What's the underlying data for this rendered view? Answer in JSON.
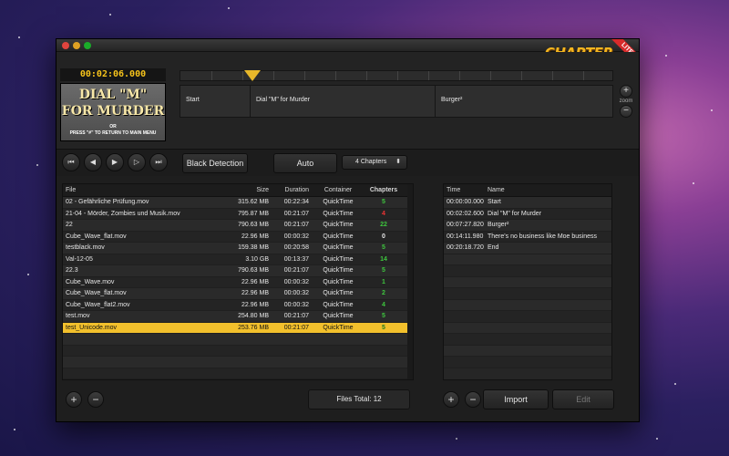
{
  "app": {
    "logo_text": "CHAPTER",
    "logo_suffix": "it",
    "badge": "LITE"
  },
  "preview": {
    "timecode": "00:02:06.000",
    "title_line1": "DIAL \"M\"",
    "title_line2": "FOR MURDER",
    "caption_line1": "OR",
    "caption_line2": "PRESS \"#\" TO RETURN TO MAIN MENU"
  },
  "timeline": {
    "playhead": "current-position"
  },
  "chapters_track": [
    {
      "label": "Start"
    },
    {
      "label": "Dial \"M\" for Murder"
    },
    {
      "label": "Burger²"
    }
  ],
  "zoom": {
    "label": "zoom",
    "plus": "+",
    "minus": "−"
  },
  "toolbar": {
    "transport": [
      {
        "name": "skip-to-start-icon",
        "glyph": "⏮"
      },
      {
        "name": "previous-icon",
        "glyph": "◀"
      },
      {
        "name": "play-icon",
        "glyph": "▶"
      },
      {
        "name": "next-icon",
        "glyph": "▷"
      },
      {
        "name": "skip-to-end-icon",
        "glyph": "⏭"
      }
    ],
    "black_detection": "Black Detection",
    "auto": "Auto",
    "chapters_select": "4 Chapters"
  },
  "file_table": {
    "headers": {
      "file": "File",
      "size": "Size",
      "duration": "Duration",
      "container": "Container",
      "chapters": "Chapters"
    },
    "rows": [
      {
        "file": "02 - Gefährliche Prüfung.mov",
        "size": "315.62 MB",
        "duration": "00:22:34",
        "container": "QuickTime",
        "chapters": "5",
        "chapters_color": "green"
      },
      {
        "file": "21-04 - Mörder, Zombies und Musik.mov",
        "size": "795.87 MB",
        "duration": "00:21:07",
        "container": "QuickTime",
        "chapters": "4",
        "chapters_color": "red"
      },
      {
        "file": "22",
        "size": "790.63 MB",
        "duration": "00:21:07",
        "container": "QuickTime",
        "chapters": "22",
        "chapters_color": "green"
      },
      {
        "file": "Cube_Wave_flat.mov",
        "size": "22.96 MB",
        "duration": "00:00:32",
        "container": "QuickTime",
        "chapters": "0",
        "chapters_color": "white"
      },
      {
        "file": "testblack.mov",
        "size": "159.38 MB",
        "duration": "00:20:58",
        "container": "QuickTime",
        "chapters": "5",
        "chapters_color": "green"
      },
      {
        "file": "Val-12-05",
        "size": "3.10 GB",
        "duration": "00:13:37",
        "container": "QuickTime",
        "chapters": "14",
        "chapters_color": "green"
      },
      {
        "file": "22.3",
        "size": "790.63 MB",
        "duration": "00:21:07",
        "container": "QuickTime",
        "chapters": "5",
        "chapters_color": "green"
      },
      {
        "file": "Cube_Wave.mov",
        "size": "22.96 MB",
        "duration": "00:00:32",
        "container": "QuickTime",
        "chapters": "1",
        "chapters_color": "green"
      },
      {
        "file": "Cube_Wave_flat.mov",
        "size": "22.96 MB",
        "duration": "00:00:32",
        "container": "QuickTime",
        "chapters": "2",
        "chapters_color": "green",
        "locked": true
      },
      {
        "file": "Cube_Wave_flat2.mov",
        "size": "22.96 MB",
        "duration": "00:00:32",
        "container": "QuickTime",
        "chapters": "4",
        "chapters_color": "green"
      },
      {
        "file": "test.mov",
        "size": "254.80 MB",
        "duration": "00:21:07",
        "container": "QuickTime",
        "chapters": "5",
        "chapters_color": "green"
      },
      {
        "file": "test_Unicode.mov",
        "size": "253.76 MB",
        "duration": "00:21:07",
        "container": "QuickTime",
        "chapters": "5",
        "chapters_color": "green",
        "selected": true
      }
    ]
  },
  "chapter_table": {
    "headers": {
      "time": "Time",
      "name": "Name"
    },
    "rows": [
      {
        "time": "00:00:00.000",
        "name": "Start"
      },
      {
        "time": "00:02:02.600",
        "name": "Dial \"M\" for Murder"
      },
      {
        "time": "00:07:27.820",
        "name": "Burger²"
      },
      {
        "time": "00:14:11.980",
        "name": "There's no business like Moe business"
      },
      {
        "time": "00:20:18.720",
        "name": "End"
      }
    ]
  },
  "bottom": {
    "files_total": "Files Total: 12",
    "import": "Import",
    "edit": "Edit",
    "add": "+",
    "remove": "−"
  },
  "colors": {
    "accent": "#f2c02c",
    "timecode": "#f6c31b",
    "green": "#3ec63e",
    "red": "#e33333"
  }
}
